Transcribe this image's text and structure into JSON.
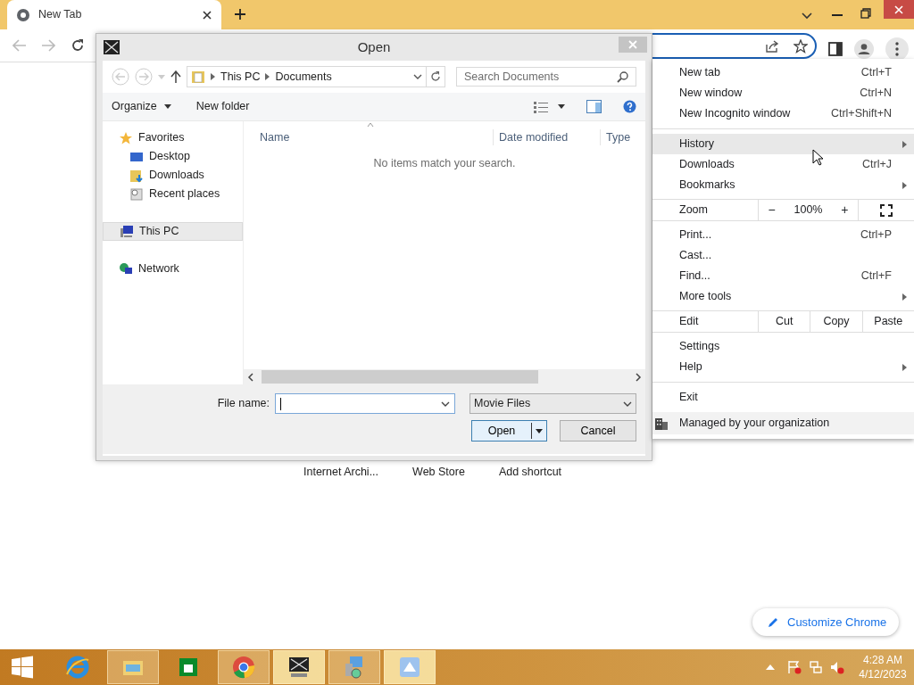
{
  "browser": {
    "tabs": [
      {
        "title": "New Tab",
        "selected": true
      }
    ],
    "shortcuts": [
      "Internet Archi...",
      "Web Store",
      "Add shortcut"
    ],
    "customize_button": "Customize Chrome"
  },
  "dialog": {
    "title": "Open",
    "path": [
      "This PC",
      "Documents"
    ],
    "search": {
      "placeholder": "Search Documents"
    },
    "toolbar": [
      "Organize",
      "New folder"
    ],
    "nav": [
      {
        "label": "Favorites",
        "kind": "favorites",
        "selected": false,
        "children": [
          {
            "label": "Desktop",
            "kind": "desktop",
            "selected": false
          },
          {
            "label": "Downloads",
            "kind": "downloads",
            "selected": false
          },
          {
            "label": "Recent places",
            "kind": "recent",
            "selected": false
          }
        ]
      },
      {
        "label": "This PC",
        "kind": "pc",
        "selected": true
      },
      {
        "label": "Network",
        "kind": "network",
        "selected": false
      }
    ],
    "columns": [
      "Name",
      "Date modified",
      "Type"
    ],
    "empty_message": "No items match your search.",
    "file_name_label": "File name:",
    "file_type": "Movie Files",
    "buttons": [
      "Open",
      "Cancel"
    ]
  },
  "menu": [
    {
      "kind": "item",
      "label": "New tab",
      "shortcut": "Ctrl+T",
      "hovered": false
    },
    {
      "kind": "item",
      "label": "New window",
      "shortcut": "Ctrl+N",
      "hovered": false
    },
    {
      "kind": "item",
      "label": "New Incognito window",
      "shortcut": "Ctrl+Shift+N",
      "hovered": false
    },
    {
      "kind": "separator"
    },
    {
      "kind": "item",
      "label": "History",
      "submenu": true,
      "hovered": true
    },
    {
      "kind": "item",
      "label": "Downloads",
      "shortcut": "Ctrl+J",
      "hovered": false
    },
    {
      "kind": "item",
      "label": "Bookmarks",
      "submenu": true,
      "hovered": false
    },
    {
      "kind": "zoom",
      "label": "Zoom",
      "minus": "−",
      "value": "100%",
      "plus": "+"
    },
    {
      "kind": "item",
      "label": "Print...",
      "shortcut": "Ctrl+P",
      "hovered": false
    },
    {
      "kind": "item",
      "label": "Cast...",
      "hovered": false
    },
    {
      "kind": "item",
      "label": "Find...",
      "shortcut": "Ctrl+F",
      "hovered": false
    },
    {
      "kind": "item",
      "label": "More tools",
      "submenu": true,
      "hovered": false
    },
    {
      "kind": "edit",
      "label": "Edit",
      "actions": [
        "Cut",
        "Copy",
        "Paste"
      ]
    },
    {
      "kind": "item",
      "label": "Settings",
      "hovered": false
    },
    {
      "kind": "item",
      "label": "Help",
      "submenu": true,
      "hovered": false
    },
    {
      "kind": "separator"
    },
    {
      "kind": "item",
      "label": "Exit",
      "hovered": false
    },
    {
      "kind": "managed",
      "label": "Managed by your organization"
    }
  ],
  "taskbar": {
    "apps": [
      {
        "kind": "ie",
        "running": false,
        "selected": false
      },
      {
        "kind": "explorer",
        "running": true,
        "selected": false
      },
      {
        "kind": "store",
        "running": false,
        "selected": false
      },
      {
        "kind": "chrome",
        "running": true,
        "selected": false
      },
      {
        "kind": "xapp",
        "running": true,
        "selected": true
      },
      {
        "kind": "setup",
        "running": true,
        "selected": false
      },
      {
        "kind": "installer",
        "running": true,
        "selected": true
      }
    ],
    "clock": {
      "time": "4:28 AM",
      "date": "4/12/2023"
    }
  }
}
